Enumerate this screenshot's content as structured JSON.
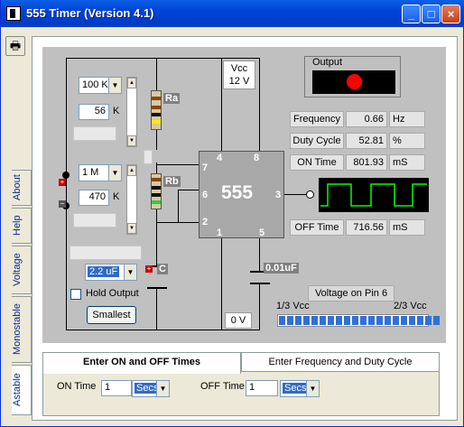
{
  "window": {
    "title": "555 Timer  (Version 4.1)"
  },
  "side_tabs": [
    "Astable",
    "Monostable",
    "Voltage",
    "Help",
    "About"
  ],
  "circuit": {
    "ra": {
      "label": "Ra",
      "multiplier": "100 K",
      "value": "56",
      "unit": "K"
    },
    "rb": {
      "label": "Rb",
      "multiplier": "1 M",
      "value": "470",
      "unit": "K"
    },
    "capacitor": {
      "label": "C",
      "value": "2.2 uF"
    },
    "cap_small": "0.01uF",
    "vcc_line1": "Vcc",
    "vcc_line2": "12 V",
    "zero_v": "0 V",
    "chip": {
      "name": "555",
      "pins": [
        "4",
        "8",
        "7",
        "6",
        "2",
        "1",
        "5",
        "3"
      ]
    },
    "hold_output": "Hold Output",
    "smallest": "Smallest"
  },
  "output": {
    "label": "Output",
    "led_color": "#ff0000"
  },
  "readouts": [
    {
      "label": "Frequency",
      "value": "0.66",
      "unit": "Hz"
    },
    {
      "label": "Duty Cycle",
      "value": "52.81",
      "unit": "%"
    },
    {
      "label": "ON Time",
      "value": "801.93",
      "unit": "mS"
    },
    {
      "label": "OFF Time",
      "value": "716.56",
      "unit": "mS"
    }
  ],
  "voltage": {
    "title": "Voltage on Pin 6",
    "left": "1/3 Vcc",
    "right": "2/3 Vcc",
    "segments": 20
  },
  "bottom_tabs": [
    "Enter ON and OFF Times",
    "Enter Frequency and Duty Cycle"
  ],
  "inputs": {
    "on_label": "ON Time",
    "on_value": "1",
    "on_unit": "Secs",
    "off_label": "OFF Time",
    "off_value": "1",
    "off_unit": "Secs"
  },
  "colors": {
    "titlebar": "#0043d6",
    "scope_trace": "#00ff00",
    "bar": "#3170d5"
  }
}
